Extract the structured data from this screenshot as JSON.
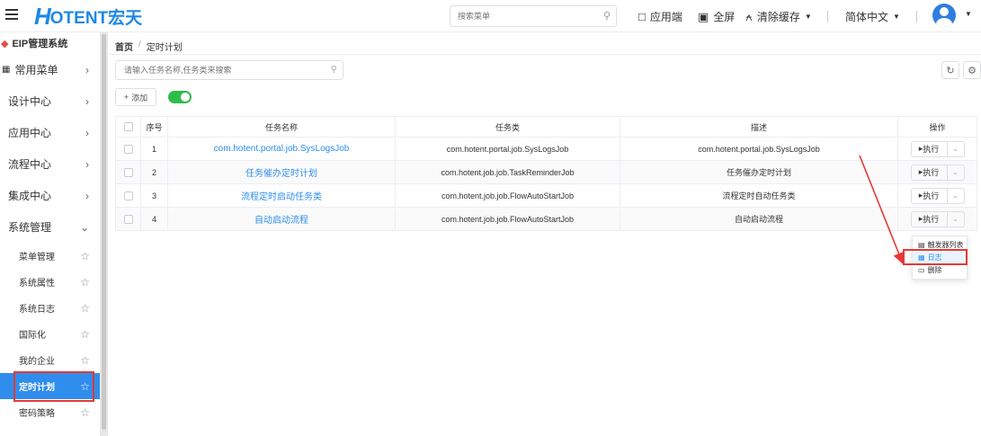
{
  "header": {
    "logo_mark": "H",
    "logo_text": "OTENT宏天",
    "search_placeholder": "搜索菜单",
    "tools": {
      "app_side": "应用端",
      "fullscreen": "全屏",
      "clear_cache": "清除缓存",
      "language": "简体中文"
    }
  },
  "sidebar": {
    "system_title": "EIP管理系统",
    "groups": [
      {
        "label": "常用菜单",
        "chevron": "›"
      },
      {
        "label": "设计中心",
        "chevron": "›"
      },
      {
        "label": "应用中心",
        "chevron": "›"
      },
      {
        "label": "流程中心",
        "chevron": "›"
      },
      {
        "label": "集成中心",
        "chevron": "›"
      },
      {
        "label": "系统管理",
        "chevron": "⌄"
      }
    ],
    "sub_items": [
      {
        "label": "菜单管理"
      },
      {
        "label": "系统属性"
      },
      {
        "label": "系统日志"
      },
      {
        "label": "国际化"
      },
      {
        "label": "我的企业"
      },
      {
        "label": "定时计划"
      },
      {
        "label": "密码策略"
      }
    ],
    "active_sub_index": 5
  },
  "breadcrumb": {
    "home": "首页",
    "separator": "/",
    "current": "定时计划"
  },
  "toolbar": {
    "search_placeholder": "请输入任务名称,任务类来搜索",
    "add_label": "添加",
    "toggle_on": true
  },
  "table": {
    "columns": {
      "index": "序号",
      "name": "任务名称",
      "class": "任务类",
      "desc": "描述",
      "ops": "操作"
    },
    "exec_label": "执行",
    "rows": [
      {
        "index": "1",
        "name": "com.hotent.portal.job.SysLogsJob",
        "class": "com.hotent.portal.job.SysLogsJob",
        "desc": "com.hotent.portal.job.SysLogsJob"
      },
      {
        "index": "2",
        "name": "任务催办定时计划",
        "class": "com.hotent.job.job.TaskReminderJob",
        "desc": "任务催办定时计划"
      },
      {
        "index": "3",
        "name": "流程定时启动任务类",
        "class": "com.hotent.job.job.FlowAutoStartJob",
        "desc": "流程定时自动任务类"
      },
      {
        "index": "4",
        "name": "自动启动流程",
        "class": "com.hotent.job.job.FlowAutoStartJob",
        "desc": "自动启动流程"
      }
    ]
  },
  "dropdown": {
    "items": [
      {
        "label": "触发器列表",
        "icon": "list-icon"
      },
      {
        "label": "日志",
        "icon": "calendar-icon"
      },
      {
        "label": "删除",
        "icon": "trash-icon"
      }
    ],
    "highlighted_index": 1
  },
  "colors": {
    "accent": "#2f8ded",
    "toggle": "#2ebd4a",
    "annotation": "#e53935"
  }
}
